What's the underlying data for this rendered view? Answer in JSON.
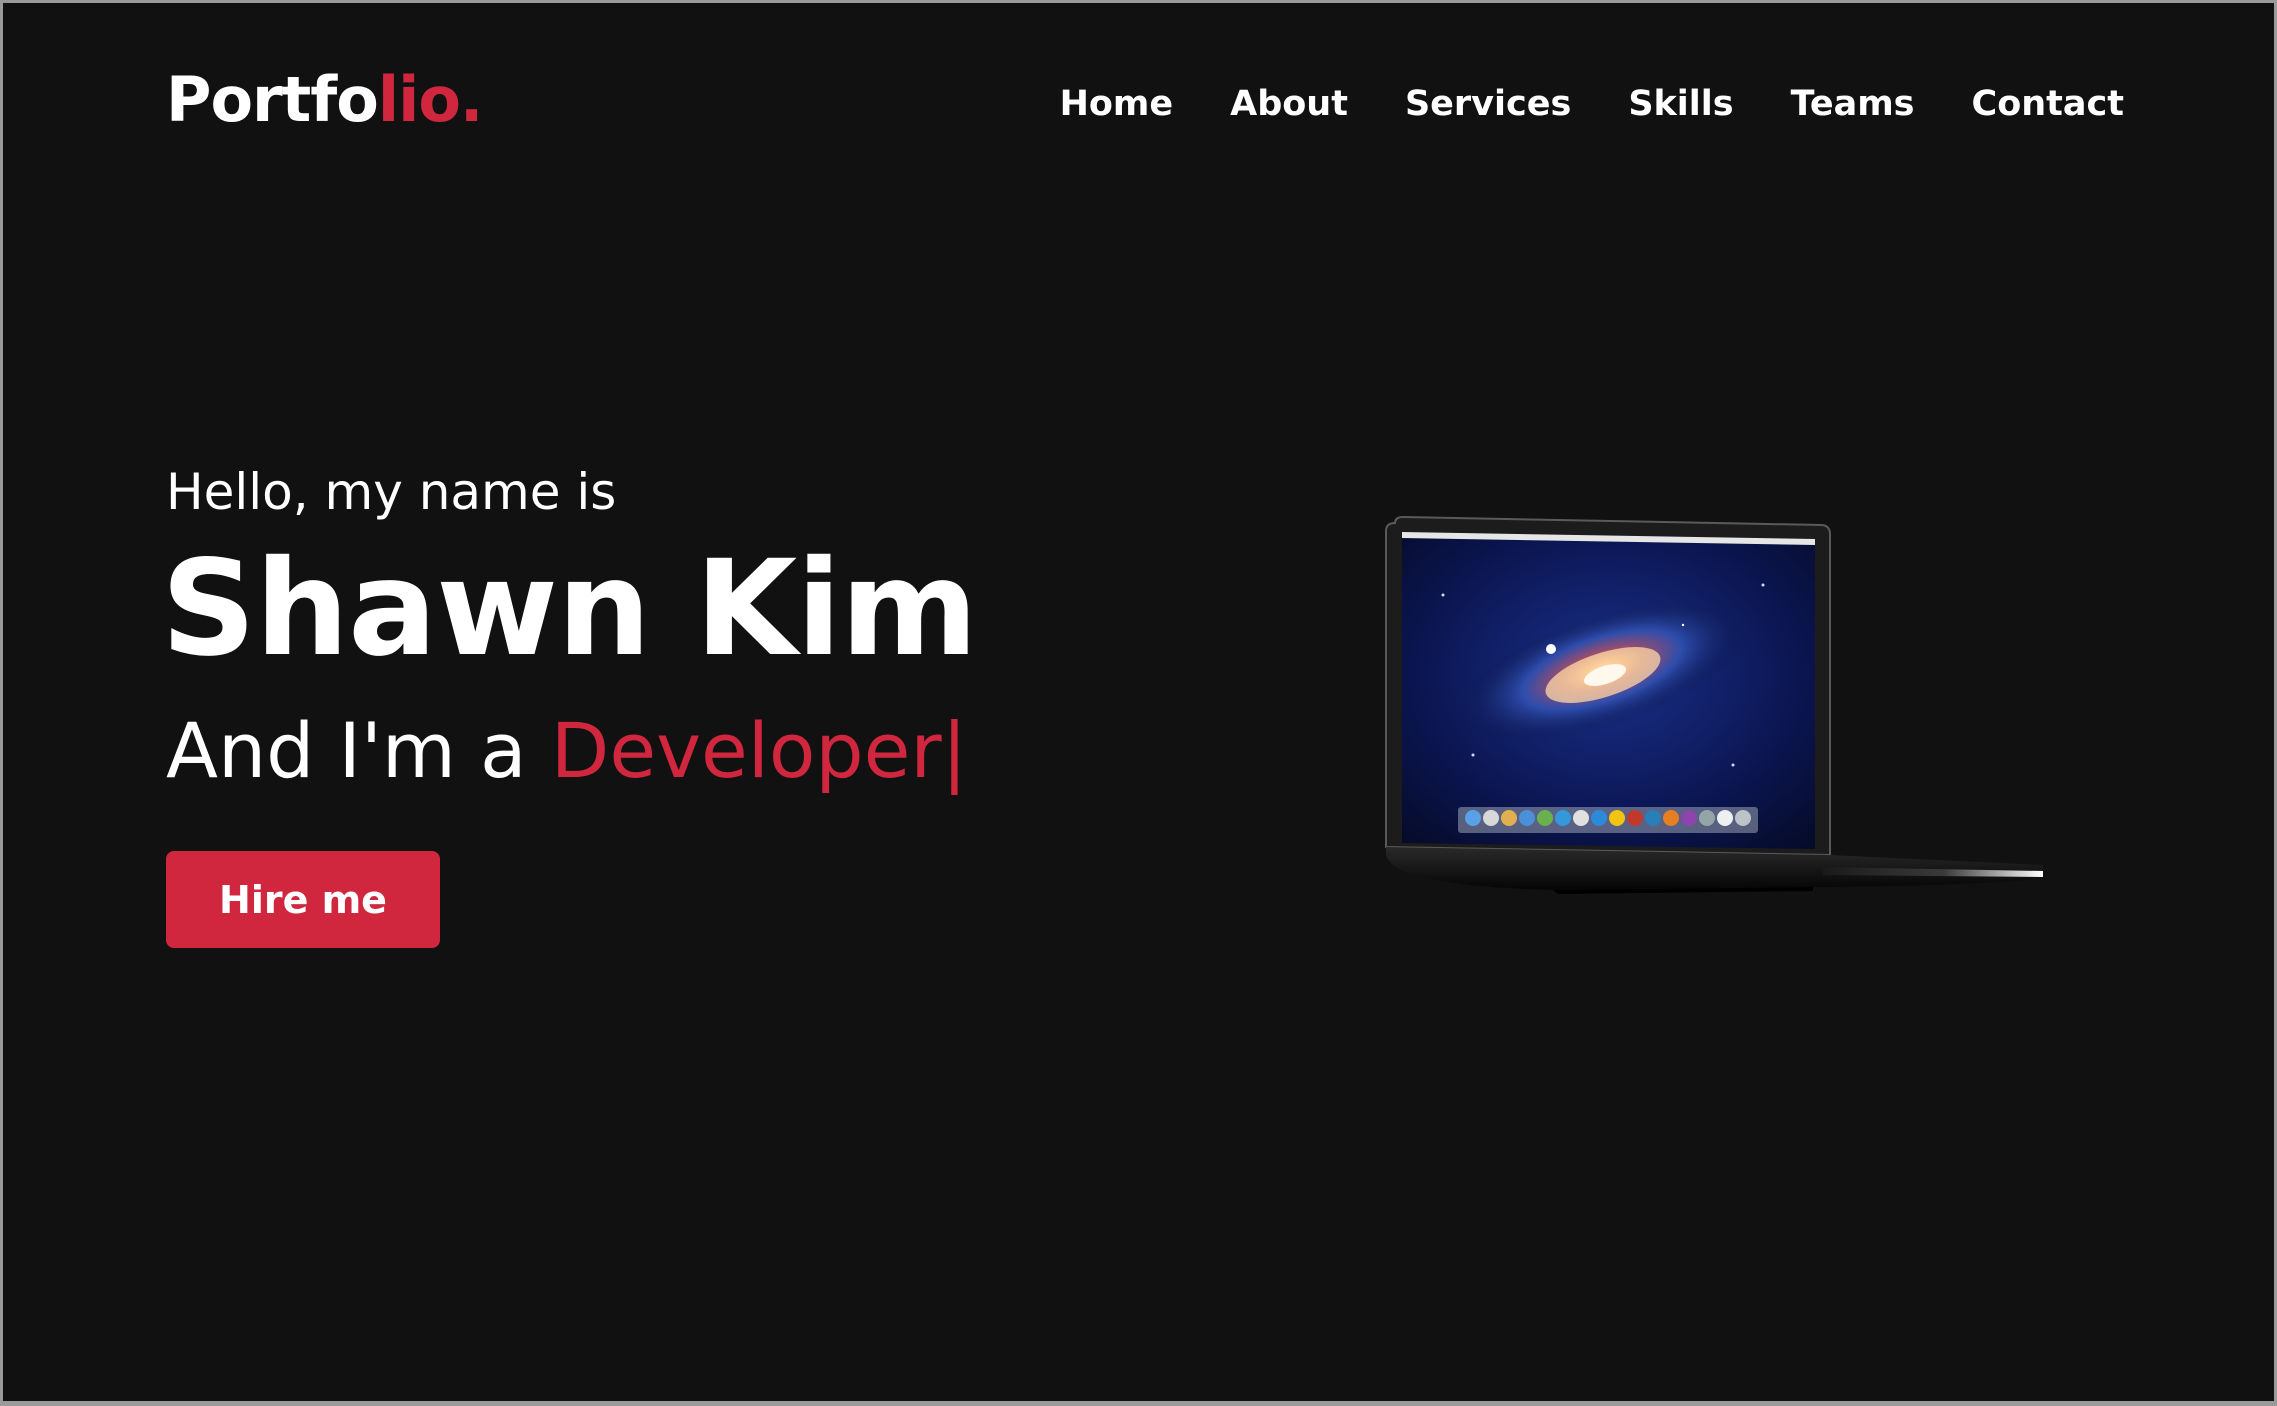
{
  "brand": {
    "logo_main": "Portfo",
    "logo_accent": "lio."
  },
  "nav": {
    "items": [
      {
        "label": "Home"
      },
      {
        "label": "About"
      },
      {
        "label": "Services"
      },
      {
        "label": "Skills"
      },
      {
        "label": "Teams"
      },
      {
        "label": "Contact"
      }
    ]
  },
  "hero": {
    "greeting": "Hello, my name is",
    "name": "Shawn Kim",
    "role_prefix": "And I'm a ",
    "role_word": "Developer",
    "cursor": "|",
    "cta_label": "Hire me"
  },
  "colors": {
    "background": "#111111",
    "accent": "#d0273f",
    "text": "#ffffff"
  },
  "icons": {
    "hero_image": "laptop-illustration"
  }
}
